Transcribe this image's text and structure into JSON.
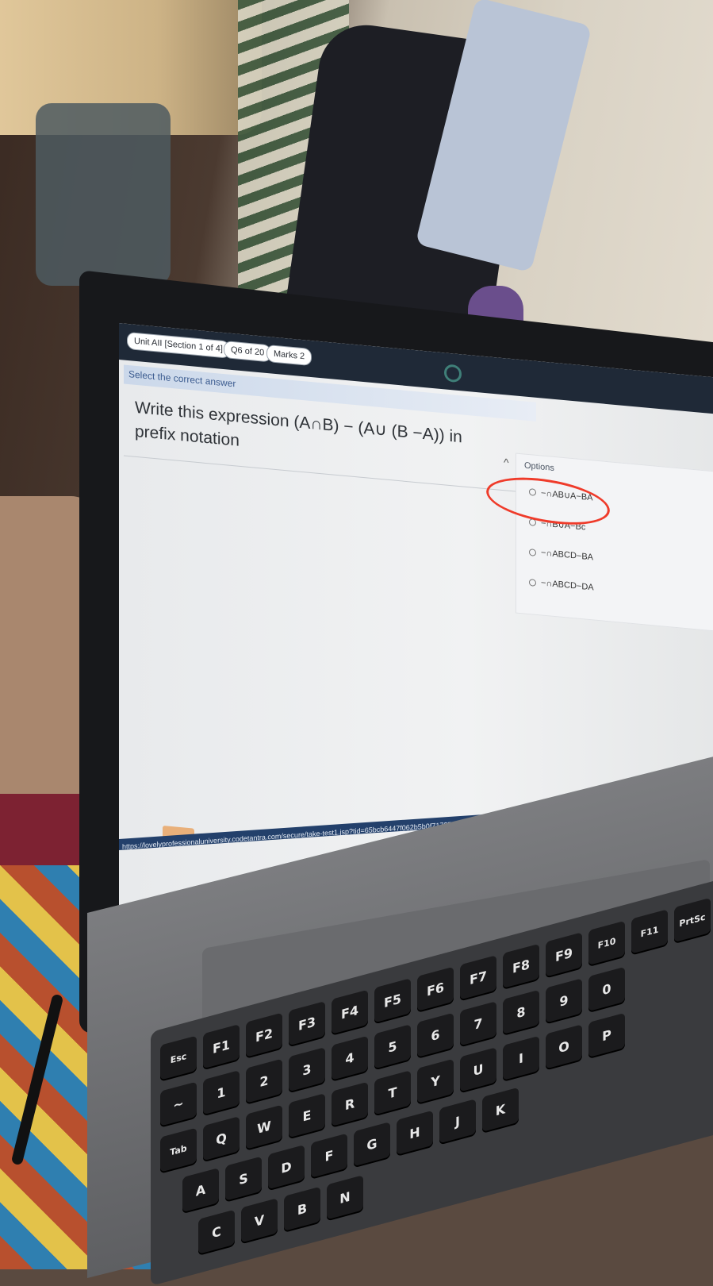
{
  "exam": {
    "section_badge": "Unit AII [Section 1 of 4]",
    "question_badge": "Q6 of 20",
    "marks_badge": "Marks 2",
    "instruction": "Select the correct answer",
    "question": "Write this expression (A∩B) − (A∪ (B −A)) in prefix notation"
  },
  "options": {
    "title": "Options",
    "items": [
      {
        "label": "−∩AB∪A−BA"
      },
      {
        "label": "−∩B∪A−Bc"
      },
      {
        "label": "−∩ABCD−BA"
      },
      {
        "label": "−∩ABCD−DA"
      }
    ]
  },
  "browser": {
    "url": "https://lovelyprofessionaluniversity.codetantra.com/secure/take-test1.jsp?tid=65bcb6447f062b5b0f71727&bd=AMTMSMBjSFTjaA%3D%3D&tc=182695&st=4"
  },
  "annotation": {
    "color": "#ef3b2a"
  },
  "keyboard": {
    "keys": [
      "Esc",
      "F1",
      "F2",
      "F3",
      "F4",
      "F5",
      "F6",
      "F7",
      "F8",
      "F9",
      "F10",
      "F11",
      "PrtSc",
      "!",
      "1",
      "@",
      "2",
      "#",
      "3",
      "$",
      "4",
      "%",
      "5",
      "6",
      "&",
      "7",
      "*",
      "8",
      "(",
      "9",
      ")",
      "0",
      "~",
      "Tab",
      "Q",
      "W",
      "E",
      "R",
      "T",
      "Y",
      "U",
      "I",
      "O",
      "P",
      "A",
      "S",
      "D",
      "F",
      "G",
      "H",
      "J",
      "K",
      "C",
      "V",
      "B",
      "N"
    ]
  }
}
